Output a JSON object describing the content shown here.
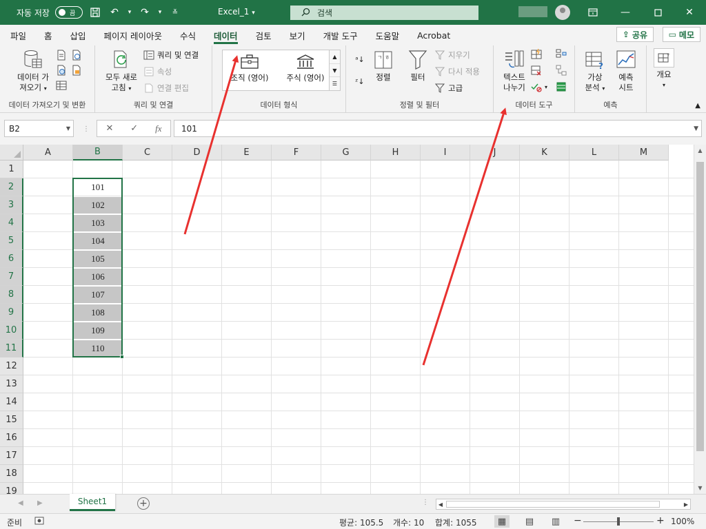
{
  "titlebar": {
    "autosave_label": "자동 저장",
    "autosave_state": "끔",
    "filename": "Excel_1",
    "search_placeholder": "검색"
  },
  "tabs": [
    "파일",
    "홈",
    "삽입",
    "페이지 레이아웃",
    "수식",
    "데이터",
    "검토",
    "보기",
    "개발 도구",
    "도움말",
    "Acrobat"
  ],
  "active_tab": "데이터",
  "share_label": "공유",
  "memo_label": "메모",
  "ribbon": {
    "get_data": {
      "line1": "데이터 가",
      "line2": "져오기",
      "group": "데이터 가져오기 및 변환"
    },
    "refresh": {
      "line1": "모두 새로",
      "line2": "고침"
    },
    "queries": {
      "connections": "쿼리 및 연결",
      "properties": "속성",
      "edit_links": "연결 편집",
      "group": "쿼리 및 연결"
    },
    "data_types": {
      "stocks_kr": "조직 (영어)",
      "stocks": "주식 (영어)",
      "group": "데이터 형식"
    },
    "sort_filter": {
      "sort": "정렬",
      "filter": "필터",
      "clear": "지우기",
      "reapply": "다시 적용",
      "advanced": "고급",
      "group": "정렬 및 필터"
    },
    "data_tools": {
      "text_to_columns_1": "텍스트",
      "text_to_columns_2": "나누기",
      "group": "데이터 도구"
    },
    "forecast": {
      "whatif_1": "가상",
      "whatif_2": "분석",
      "sheet_1": "예측",
      "sheet_2": "시트",
      "group": "예측"
    },
    "outline": {
      "label": "개요"
    }
  },
  "formula_bar": {
    "name_box": "B2",
    "value": "101"
  },
  "columns": [
    "A",
    "B",
    "C",
    "D",
    "E",
    "F",
    "G",
    "H",
    "I",
    "J",
    "K",
    "L",
    "M"
  ],
  "rows": [
    "1",
    "2",
    "3",
    "4",
    "5",
    "6",
    "7",
    "8",
    "9",
    "10",
    "11",
    "12",
    "13",
    "14",
    "15",
    "16",
    "17",
    "18",
    "19"
  ],
  "selected_column": "B",
  "selected_rows": [
    "2",
    "3",
    "4",
    "5",
    "6",
    "7",
    "8",
    "9",
    "10",
    "11"
  ],
  "cells_b": [
    "101",
    "102",
    "103",
    "104",
    "105",
    "106",
    "107",
    "108",
    "109",
    "110"
  ],
  "sheet_tab": "Sheet1",
  "status": {
    "ready": "준비",
    "average": "평균: 105.5",
    "count": "개수: 10",
    "sum": "합계: 1055",
    "zoom": "100%"
  },
  "colors": {
    "brand": "#217346",
    "arrow": "#e8312f"
  }
}
